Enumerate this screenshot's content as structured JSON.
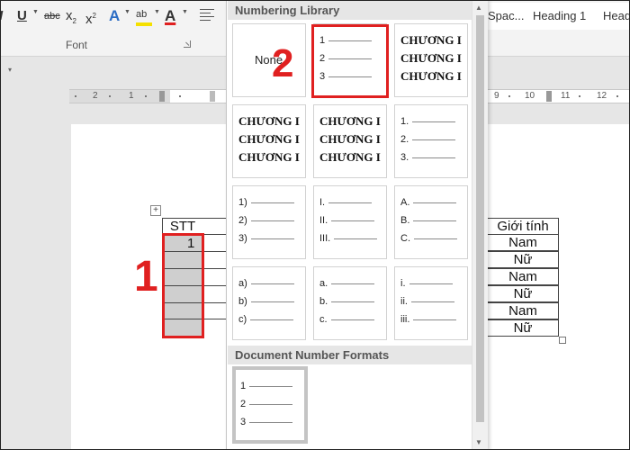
{
  "ribbon": {
    "font_group_label": "Font",
    "buttons": {
      "italic": "I",
      "underline": "U",
      "strikethrough": "abc",
      "subscript": "x",
      "subscript_mark": "2",
      "superscript": "x",
      "superscript_mark": "2",
      "text_effects": "A",
      "highlight": "ab",
      "font_color": "A"
    },
    "styles": [
      "Spac...",
      "Heading 1",
      "Head"
    ]
  },
  "ruler": {
    "left_numbers": [
      "2",
      "1"
    ],
    "right_numbers": [
      "9",
      "10",
      "11",
      "12"
    ]
  },
  "table": {
    "header_stt": "STT",
    "header_gender": "Giới tính",
    "first_stt_value": "1",
    "gender_values": [
      "Nam",
      "Nữ",
      "Nam",
      "Nữ",
      "Nam",
      "Nữ"
    ]
  },
  "annotations": {
    "step1": "1",
    "step2": "2"
  },
  "dropdown": {
    "library_title": "Numbering Library",
    "document_title": "Document Number Formats",
    "none_label": "None",
    "format_123": [
      "1",
      "2",
      "3"
    ],
    "chuong": "CHƯƠNG I",
    "format_dot": [
      "1.",
      "2.",
      "3."
    ],
    "format_paren": [
      "1)",
      "2)",
      "3)"
    ],
    "format_roman_upper": [
      "I.",
      "II.",
      "III."
    ],
    "format_alpha_upper": [
      "A.",
      "B.",
      "C."
    ],
    "format_alpha_paren": [
      "a)",
      "b)",
      "c)"
    ],
    "format_alpha_dot": [
      "a.",
      "b.",
      "c."
    ],
    "format_roman_lower": [
      "i.",
      "ii.",
      "iii."
    ],
    "document_format": [
      "1",
      "2",
      "3"
    ]
  },
  "colors": {
    "highlight_red": "#e02020",
    "highlight_yellow": "#f5e000",
    "font_color_red": "#e02020",
    "text_effects_blue": "#2b6cc4"
  }
}
